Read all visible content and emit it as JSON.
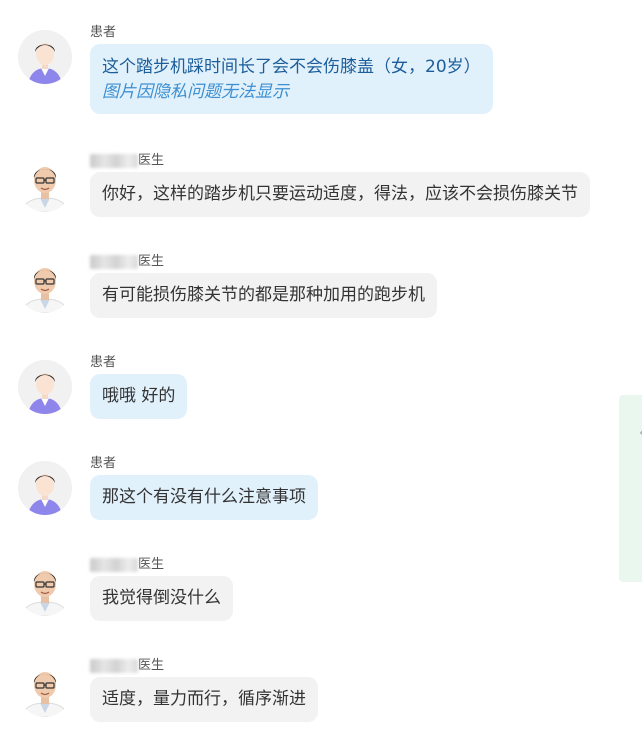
{
  "messages": [
    {
      "role": "patient",
      "sender": "患者",
      "sender_blurred": false,
      "lines": [
        "这个踏步机踩时间长了会不会伤膝盖（女，20岁）"
      ],
      "hint": "图片因隐私问题无法显示"
    },
    {
      "role": "doctor",
      "sender": "医生",
      "sender_blurred": true,
      "lines": [
        "你好，这样的踏步机只要运动适度，得法，应该不会损伤膝关节"
      ]
    },
    {
      "role": "doctor",
      "sender": "医生",
      "sender_blurred": true,
      "lines": [
        "有可能损伤膝关节的都是那种加用的跑步机"
      ]
    },
    {
      "role": "patient",
      "sender": "患者",
      "sender_blurred": false,
      "lines": [
        "哦哦 好的"
      ]
    },
    {
      "role": "patient",
      "sender": "患者",
      "sender_blurred": false,
      "lines": [
        "那这个有没有什么注意事项"
      ]
    },
    {
      "role": "doctor",
      "sender": "医生",
      "sender_blurred": true,
      "lines": [
        "我觉得倒没什么"
      ]
    },
    {
      "role": "doctor",
      "sender": "医生",
      "sender_blurred": true,
      "lines": [
        "适度，量力而行，循序渐进"
      ]
    }
  ],
  "colors": {
    "patient_bubble": "#e1f1fc",
    "doctor_bubble": "#f2f2f2",
    "side_panel": "#eaf7ef"
  },
  "icons": {
    "patient_avatar": "patient-avatar-icon",
    "doctor_avatar": "doctor-avatar-icon"
  }
}
